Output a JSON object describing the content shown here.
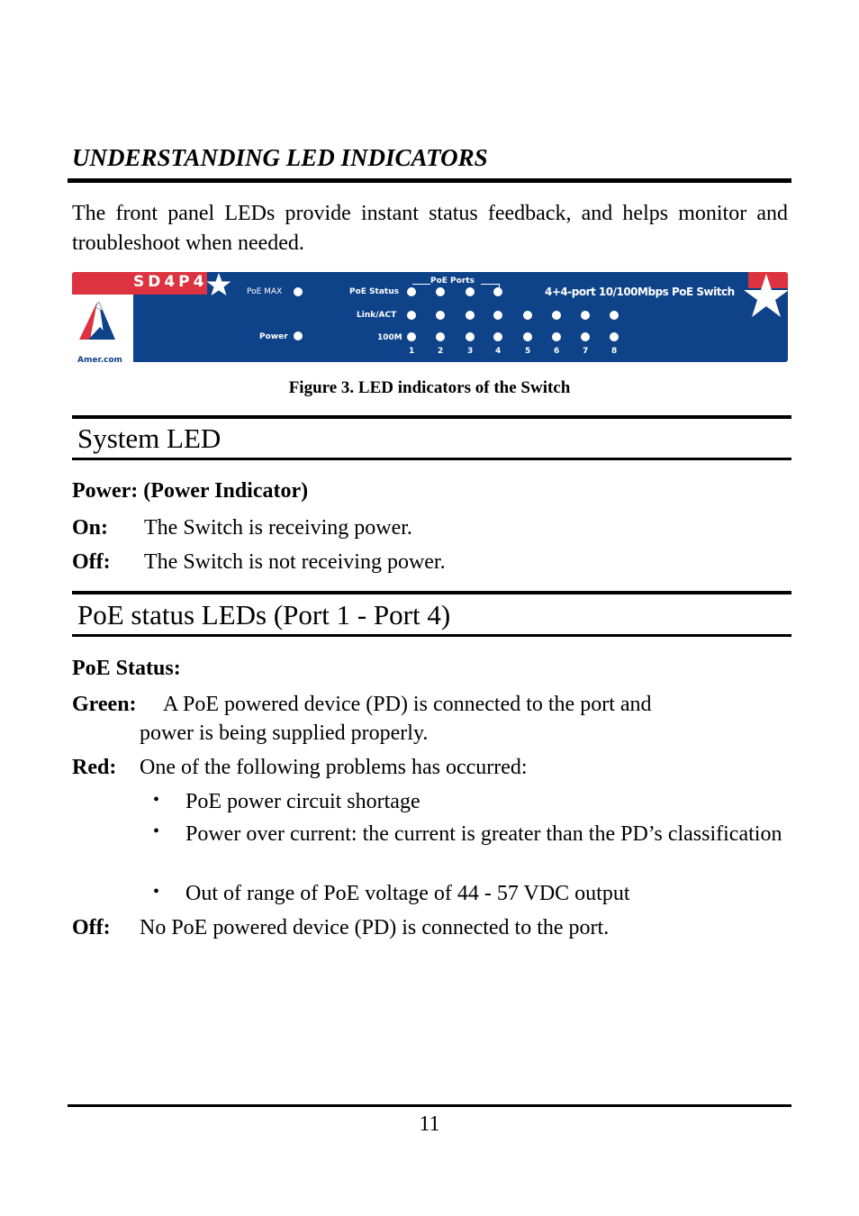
{
  "heading": "UNDERSTANDING LED INDICATORS",
  "intro": "The front panel LEDs provide instant status feedback, and helps monitor and troubleshoot when needed.",
  "figure": {
    "caption": "Figure 3. LED indicators of the Switch",
    "panel": {
      "model": "SD4P4",
      "brand": "Amer.com",
      "product_title": "4+4-port 10/100Mbps  PoE Switch",
      "labels": {
        "poe_max": "PoE MAX",
        "power": "Power",
        "poe_status": "PoE Status",
        "link_act": "Link/ACT",
        "speed": "100M",
        "poe_ports": "PoE Ports"
      },
      "port_numbers": [
        "1",
        "2",
        "3",
        "4",
        "5",
        "6",
        "7",
        "8"
      ],
      "colors": {
        "panel_blue": "#0e4289",
        "accent_red": "#dd3340",
        "led": "#ffffff"
      }
    }
  },
  "sections": [
    {
      "title": "System LED",
      "subheading": "Power: (Power Indicator)",
      "items": [
        {
          "label": "On:",
          "text": "The Switch is receiving power."
        },
        {
          "label": "Off:",
          "text": "The Switch is not receiving power."
        }
      ]
    },
    {
      "title": "PoE status LEDs (Port 1 - Port 4)",
      "subheading": "PoE Status:",
      "green": {
        "label": "Green:",
        "text_line1": "A PoE powered device (PD) is connected to the port and",
        "text_line2": "power is being supplied properly."
      },
      "red": {
        "label": "Red:",
        "text": "One of the following problems has occurred:",
        "bullets": [
          "PoE power circuit shortage",
          "Power over current: the current is greater than the PD’s classification",
          "Out of range of PoE voltage of 44 - 57 VDC output"
        ]
      },
      "off": {
        "label": "Off:",
        "text": "No PoE powered device (PD) is connected to the port."
      }
    }
  ],
  "footer": {
    "page_number": "11"
  }
}
